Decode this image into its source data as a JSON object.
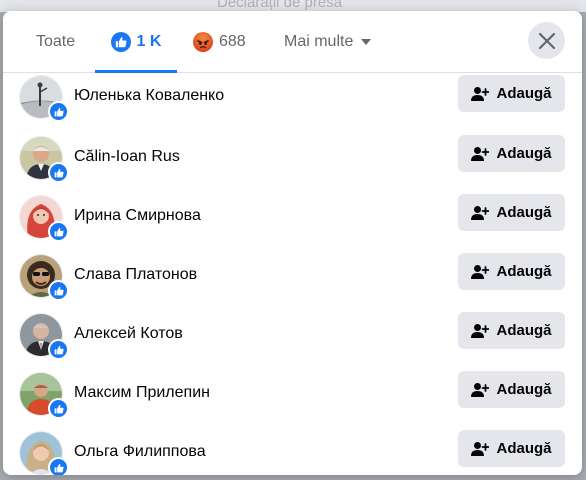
{
  "background": {
    "text": "Declarații de presă"
  },
  "tabs": {
    "all": "Toate",
    "like": {
      "icon": "like-icon",
      "count": "1 K",
      "color": "#1877f2"
    },
    "angry": {
      "icon": "angry-face-icon",
      "count": "688"
    },
    "more": "Mai multe"
  },
  "close": {
    "icon": "close-icon"
  },
  "add_label": "Adaugă",
  "people": [
    {
      "name": "Юленька Коваленко",
      "reaction": "like"
    },
    {
      "name": "Călin-Ioan Rus",
      "reaction": "like"
    },
    {
      "name": "Ирина Смирнова",
      "reaction": "like"
    },
    {
      "name": "Слава Платонов",
      "reaction": "like"
    },
    {
      "name": "Алексей Котов",
      "reaction": "like"
    },
    {
      "name": "Максим Прилепин",
      "reaction": "like"
    },
    {
      "name": "Ольга Филиппова",
      "reaction": "like"
    }
  ]
}
